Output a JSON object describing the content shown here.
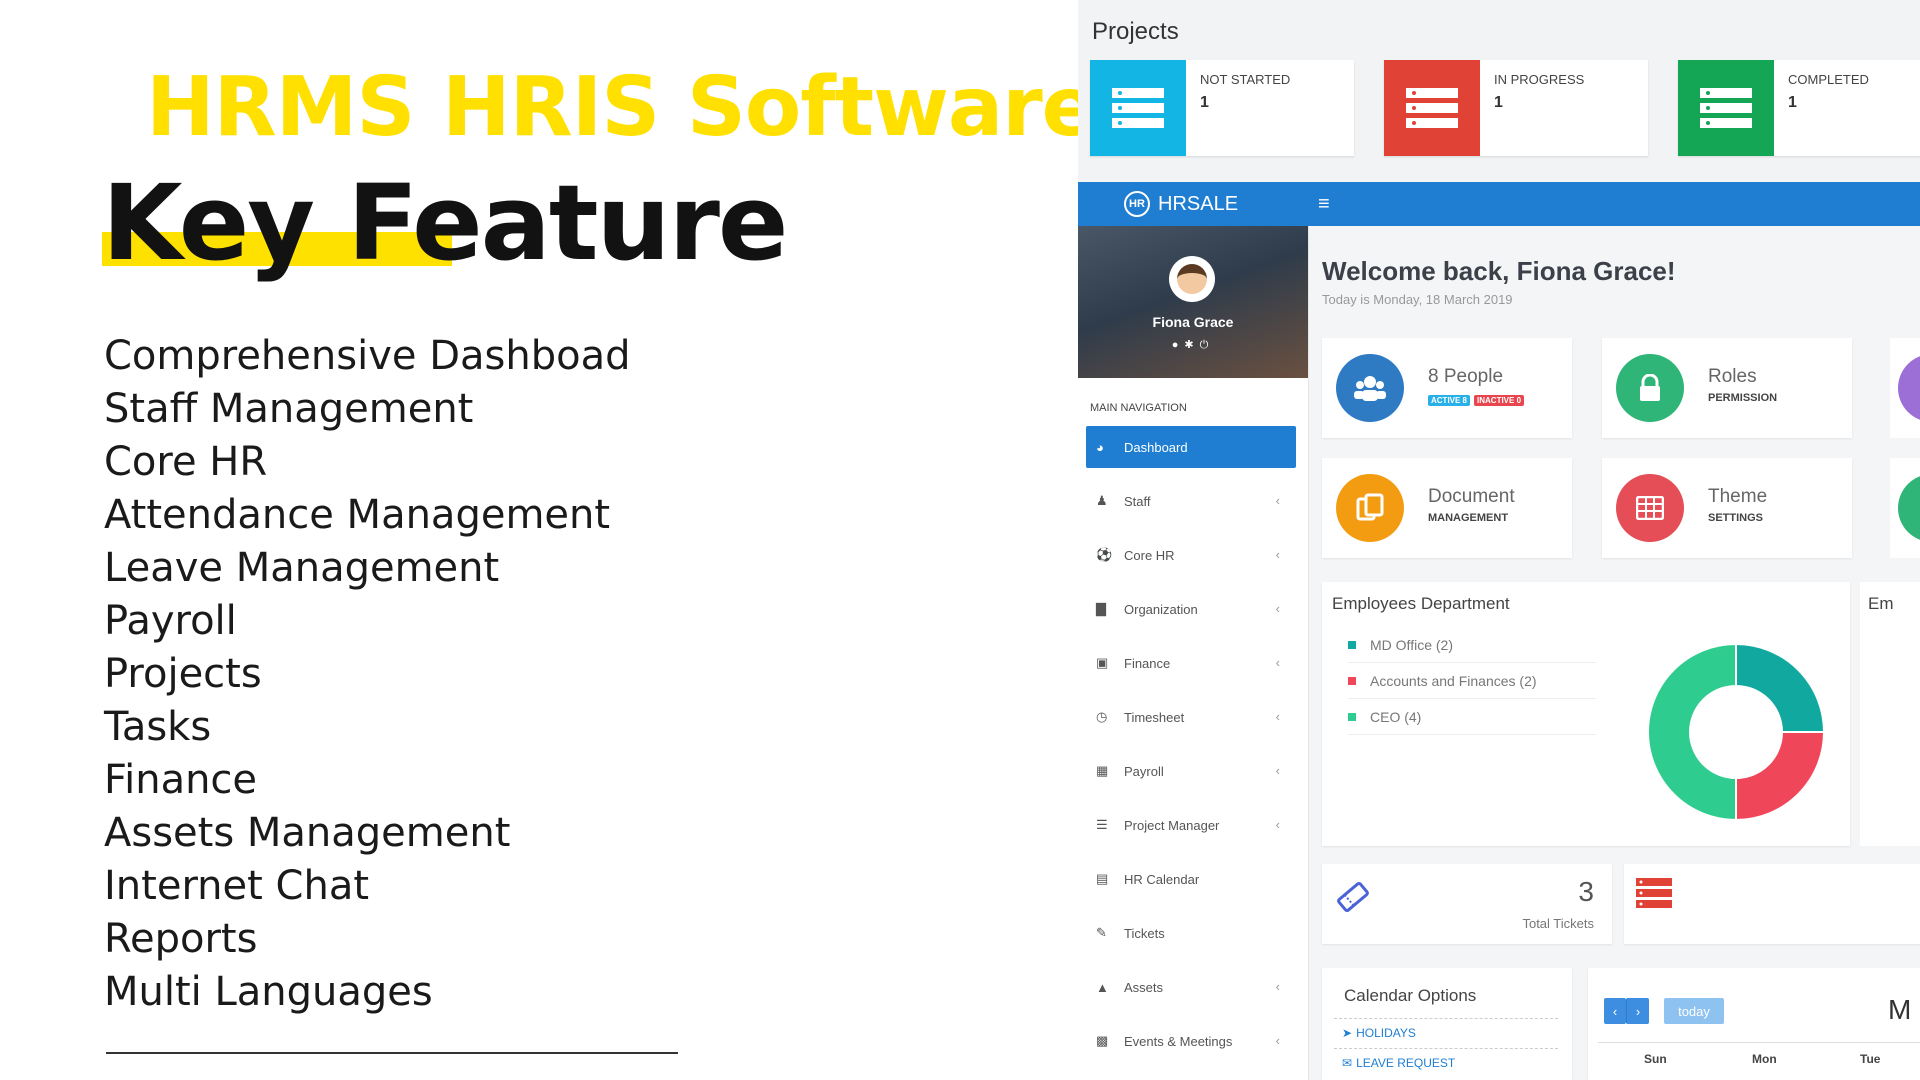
{
  "promo": {
    "headline": "HRMS HRIS Software",
    "subhead": "Key Feature",
    "features": [
      "Comprehensive Dashboad",
      "Staff Management",
      "Core HR",
      "Attendance Management",
      "Leave Management",
      "Payroll",
      "Projects",
      "Tasks",
      "Finance",
      "Assets Management",
      "Internet Chat",
      "Reports",
      "Multi Languages"
    ]
  },
  "projects": {
    "title": "Projects",
    "cards": [
      {
        "label": "NOT STARTED",
        "count": "1",
        "color": "#12b5e4"
      },
      {
        "label": "IN PROGRESS",
        "count": "1",
        "color": "#e04236"
      },
      {
        "label": "COMPLETED",
        "count": "1",
        "color": "#14a555"
      }
    ]
  },
  "app": {
    "brand": "HRSALE",
    "brand_badge": "HR",
    "accent": "#1f7ed1"
  },
  "profile": {
    "name": "Fiona Grace"
  },
  "nav": {
    "heading": "MAIN NAVIGATION",
    "items": [
      {
        "label": "Dashboard",
        "icon": "dashboard-icon",
        "active": true
      },
      {
        "label": "Staff",
        "icon": "user-icon"
      },
      {
        "label": "Core HR",
        "icon": "core-hr-icon"
      },
      {
        "label": "Organization",
        "icon": "building-icon"
      },
      {
        "label": "Finance",
        "icon": "money-icon"
      },
      {
        "label": "Timesheet",
        "icon": "clock-icon"
      },
      {
        "label": "Payroll",
        "icon": "calculator-icon"
      },
      {
        "label": "Project Manager",
        "icon": "tasks-icon"
      },
      {
        "label": "HR Calendar",
        "icon": "calendar-icon"
      },
      {
        "label": "Tickets",
        "icon": "ticket-icon"
      },
      {
        "label": "Assets",
        "icon": "flask-icon"
      },
      {
        "label": "Events & Meetings",
        "icon": "event-icon"
      }
    ]
  },
  "dashboard": {
    "welcome": "Welcome back, Fiona Grace!",
    "today": "Today is Monday, 18 March 2019",
    "stats": [
      {
        "main": "8 People",
        "sub": "",
        "badges": [
          "ACTIVE 8",
          "INACTIVE 0"
        ],
        "color": "#2e7bc4",
        "icon": "people-icon"
      },
      {
        "main": "Roles",
        "sub": "PERMISSION",
        "color": "#2fb577",
        "icon": "lock-icon"
      },
      {
        "main": "Document",
        "sub": "MANAGEMENT",
        "color": "#f39c12",
        "icon": "document-icon"
      },
      {
        "main": "Theme",
        "sub": "SETTINGS",
        "color": "#e54d57",
        "icon": "grid-icon"
      }
    ],
    "employees_department": {
      "title": "Employees Department",
      "edge_title": "Em"
    },
    "tickets": {
      "count": "3",
      "label": "Total Tickets"
    },
    "calendar_options": {
      "title": "Calendar Options",
      "links": [
        "HOLIDAYS",
        "LEAVE REQUEST"
      ]
    },
    "calendar": {
      "today_label": "today",
      "prev": "‹",
      "next": "›",
      "days": [
        "Sun",
        "Mon",
        "Tue"
      ],
      "month_partial": "M"
    }
  },
  "chart_data": {
    "type": "pie",
    "categories": [
      "MD Office (2)",
      "Accounts and Finances (2)",
      "CEO (4)"
    ],
    "values": [
      2,
      2,
      4
    ],
    "colors": [
      "#11a8a0",
      "#f0465a",
      "#2ecc8e"
    ],
    "title": "Employees Department"
  }
}
